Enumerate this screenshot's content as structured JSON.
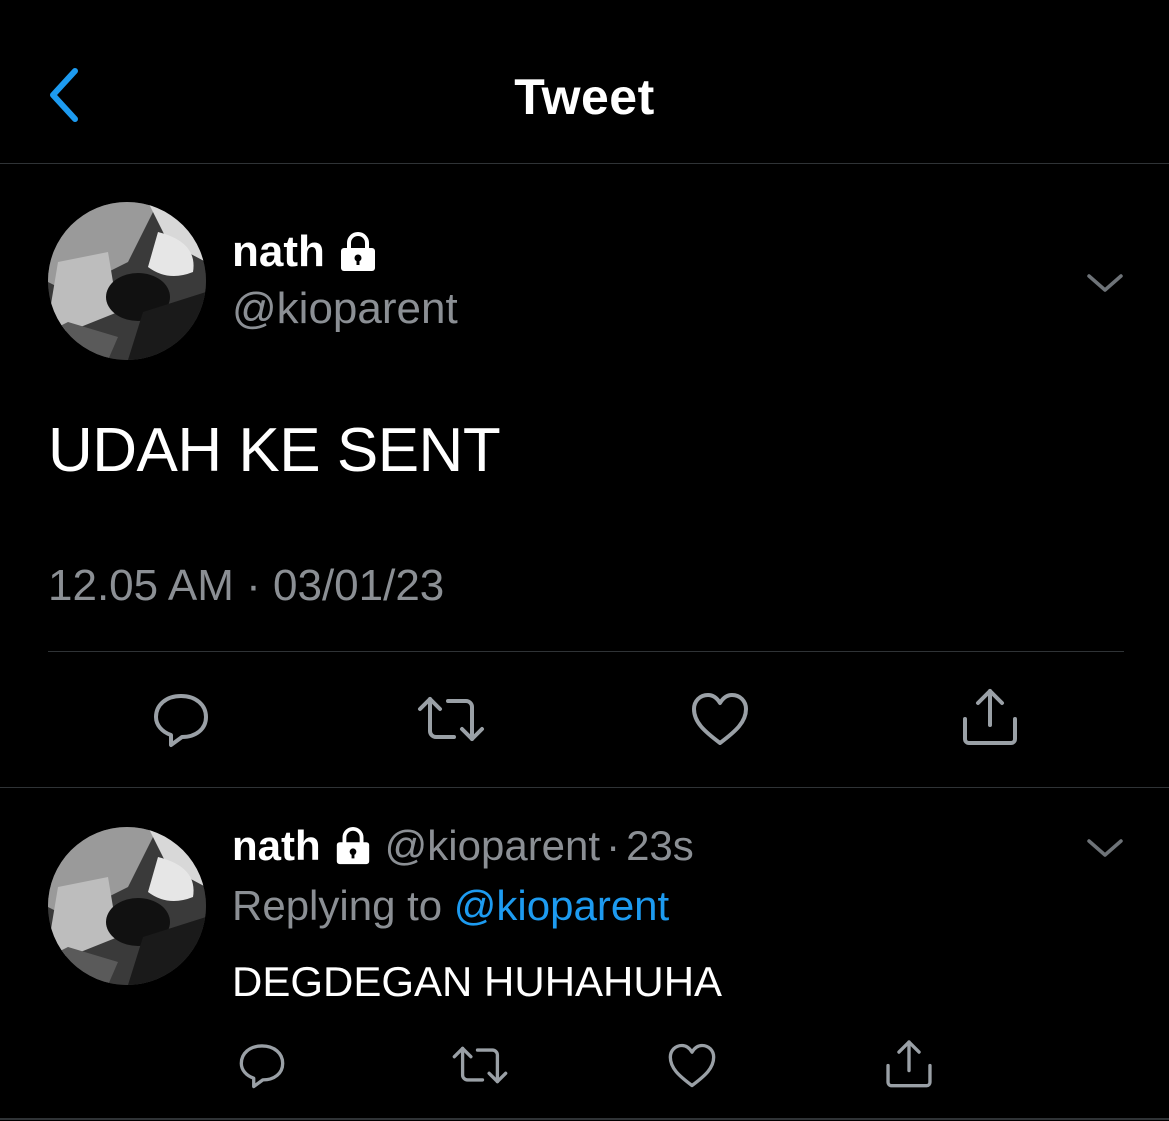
{
  "header": {
    "title": "Tweet"
  },
  "tweet": {
    "author_name": "nath",
    "author_handle": "@kioparent",
    "text": "UDAH KE SENT",
    "timestamp": "12.05 AM · 03/01/23"
  },
  "reply": {
    "author_name": "nath",
    "author_handle": "@kioparent",
    "separator": "·",
    "age": "23s",
    "replying_prefix": "Replying to",
    "replying_mention": "@kioparent",
    "text": "DEGDEGAN HUHAHUHA"
  },
  "icons": {
    "back": "chevron-left-icon",
    "lock": "lock-icon",
    "caret": "chevron-down-icon",
    "reply": "reply-bubble-icon",
    "retweet": "retweet-icon",
    "like": "heart-icon",
    "share": "share-icon"
  },
  "colors": {
    "background": "#000000",
    "accent": "#1d9bf0",
    "secondary_text": "#8b8f94",
    "divider": "#2f3336"
  }
}
